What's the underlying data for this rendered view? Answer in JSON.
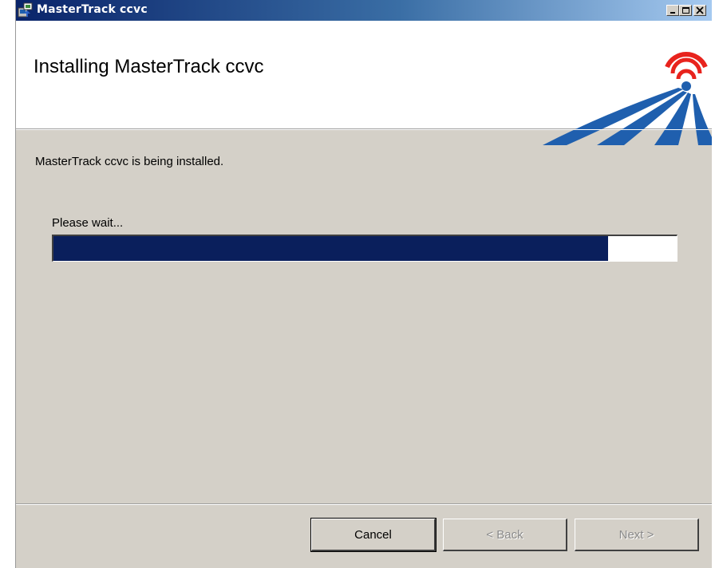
{
  "window": {
    "title": "MasterTrack ccvc",
    "icons": {
      "app": "installer-icon",
      "minimize": "minimize-icon",
      "maximize": "maximize-icon",
      "close": "close-icon"
    }
  },
  "header": {
    "title": "Installing MasterTrack ccvc",
    "logo": "signal-road-logo"
  },
  "body": {
    "status": "MasterTrack ccvc is being installed.",
    "wait_label": "Please wait...",
    "progress_fraction": 0.89,
    "progress_color": "#0a1f5c"
  },
  "footer": {
    "cancel_label": "Cancel",
    "back_label": "< Back",
    "next_label": "Next >"
  },
  "colors": {
    "dialog_bg": "#d4d0c8",
    "titlebar_start": "#0a246a",
    "logo_red": "#e8231d",
    "logo_blue": "#1f5fae"
  }
}
